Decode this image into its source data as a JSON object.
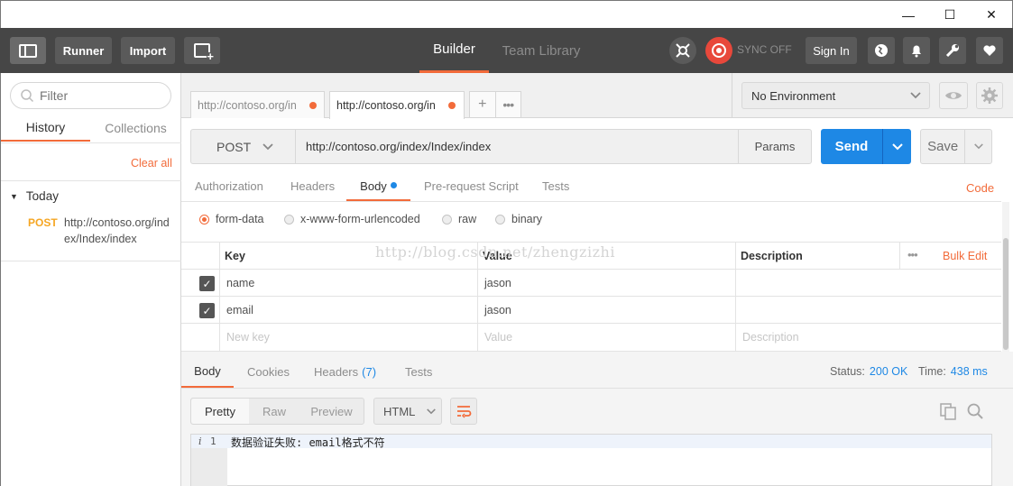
{
  "window": {
    "minimize_glyph": "—",
    "maximize_glyph": "☐",
    "close_glyph": "✕"
  },
  "header": {
    "runner_label": "Runner",
    "import_label": "Import",
    "tabs": [
      {
        "label": "Builder"
      },
      {
        "label": "Team Library"
      }
    ],
    "sync_label": "SYNC OFF",
    "signin_label": "Sign In"
  },
  "sidebar": {
    "filter_placeholder": "Filter",
    "tabs": [
      {
        "label": "History"
      },
      {
        "label": "Collections"
      }
    ],
    "clear_all": "Clear all",
    "group_label": "Today",
    "items": [
      {
        "method": "POST",
        "url": "http://contoso.org/index/Index/index"
      }
    ]
  },
  "request_tabs": [
    {
      "label": "http://contoso.org/in"
    },
    {
      "label": "http://contoso.org/in"
    }
  ],
  "environment": {
    "selected": "No Environment"
  },
  "request": {
    "method": "POST",
    "url": "http://contoso.org/index/Index/index",
    "params_label": "Params",
    "send_label": "Send",
    "save_label": "Save",
    "subtabs": [
      {
        "label": "Authorization"
      },
      {
        "label": "Headers"
      },
      {
        "label": "Body"
      },
      {
        "label": "Pre-request Script"
      },
      {
        "label": "Tests"
      }
    ],
    "code_label": "Code",
    "body_types": [
      {
        "label": "form-data"
      },
      {
        "label": "x-www-form-urlencoded"
      },
      {
        "label": "raw"
      },
      {
        "label": "binary"
      }
    ],
    "table": {
      "headers": {
        "key": "Key",
        "value": "Value",
        "description": "Description",
        "bulk_edit": "Bulk Edit"
      },
      "rows": [
        {
          "key": "name",
          "value": "jason"
        },
        {
          "key": "email",
          "value": "jason"
        }
      ],
      "placeholder": {
        "key": "New key",
        "value": "Value",
        "description": "Description"
      }
    }
  },
  "watermark": "http://blog.csdn.net/zhengzizhi",
  "response": {
    "tabs": {
      "body": "Body",
      "cookies": "Cookies",
      "headers": "Headers",
      "headers_count": "(7)",
      "tests": "Tests"
    },
    "status_label": "Status:",
    "status_value": "200 OK",
    "time_label": "Time:",
    "time_value": "438 ms",
    "view_modes": [
      {
        "label": "Pretty"
      },
      {
        "label": "Raw"
      },
      {
        "label": "Preview"
      }
    ],
    "format": "HTML",
    "line_info": "i",
    "line_number": "1",
    "line_text": "数据验证失败: email格式不符"
  },
  "colors": {
    "accent": "#f26b3a",
    "primary": "#1e88e5",
    "topbar": "#464646"
  }
}
